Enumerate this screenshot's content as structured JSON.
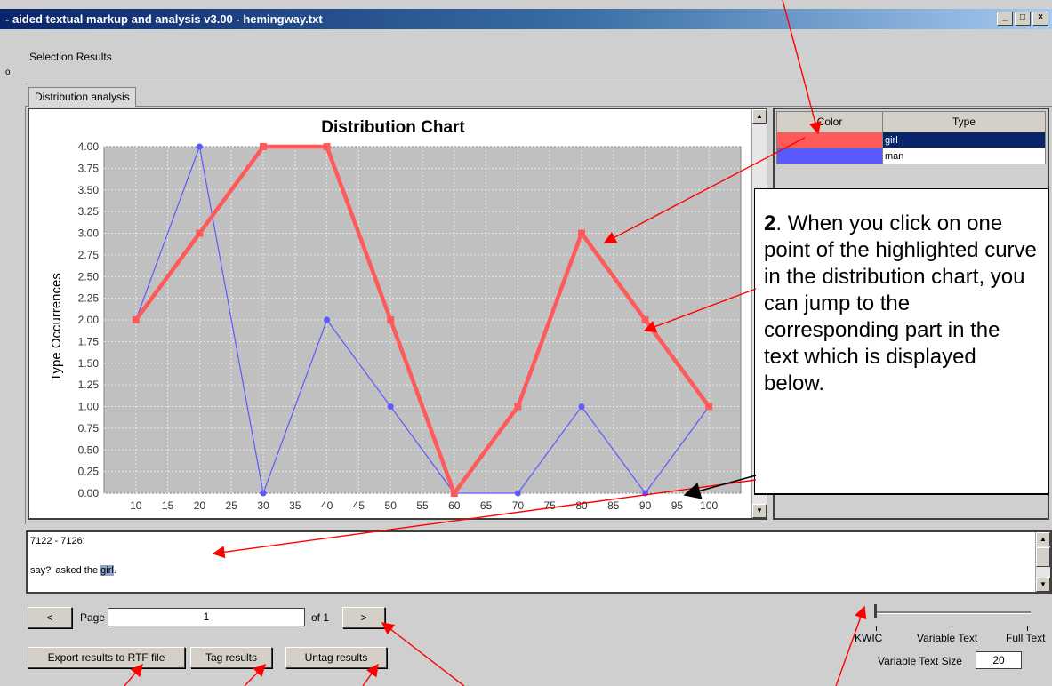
{
  "window": {
    "title": "- aided textual markup and analysis v3.00  - hemingway.txt"
  },
  "selection_results_label": "Selection Results",
  "tab_label": "Distribution analysis",
  "chart_data": {
    "type": "line",
    "title": "Distribution Chart",
    "ylabel": "Type Occurrences",
    "xlabel": "",
    "x": [
      10,
      20,
      30,
      40,
      50,
      60,
      70,
      80,
      90,
      100
    ],
    "xlim": [
      5,
      105
    ],
    "ylim": [
      0,
      4
    ],
    "x_ticks": [
      "10",
      "15",
      "20",
      "25",
      "30",
      "35",
      "40",
      "45",
      "50",
      "55",
      "60",
      "65",
      "70",
      "75",
      "80",
      "85",
      "90",
      "95",
      "100"
    ],
    "y_ticks": [
      "0.00",
      "0.25",
      "0.50",
      "0.75",
      "1.00",
      "1.25",
      "1.50",
      "1.75",
      "2.00",
      "2.25",
      "2.50",
      "2.75",
      "3.00",
      "3.25",
      "3.50",
      "3.75",
      "4.00"
    ],
    "grid": true,
    "series": [
      {
        "name": "girl",
        "color": "#ff5a5a",
        "marker": "square",
        "highlighted": true,
        "values": [
          2,
          3,
          4,
          4,
          2,
          0,
          1,
          3,
          2,
          1
        ]
      },
      {
        "name": "man",
        "color": "#5a5aff",
        "marker": "circle",
        "highlighted": false,
        "values": [
          2,
          4,
          0,
          2,
          1,
          0,
          0,
          1,
          0,
          1
        ]
      }
    ]
  },
  "legend_table": {
    "headers": [
      "Color",
      "Type"
    ],
    "rows": [
      {
        "color": "#ff5a5a",
        "type": "girl",
        "selected": true
      },
      {
        "color": "#5a5aff",
        "type": "man",
        "selected": false
      }
    ]
  },
  "note": {
    "number": "2",
    "text": ". When you click on one point of the highlighted curve in the distribution chart, you can jump to the corresponding part in the text which is displayed below."
  },
  "text_result": {
    "range": "7122 - 7126:",
    "before": "say?' asked the ",
    "match": "girl",
    "after": "."
  },
  "pager": {
    "prev": "<",
    "page_label": "Page",
    "page_value": "1",
    "of_label": "of 1",
    "next": ">"
  },
  "buttons": {
    "export": "Export results to RTF file",
    "tag": "Tag results",
    "untag": "Untag results"
  },
  "slider": {
    "labels": [
      "KWIC",
      "Variable Text",
      "Full Text"
    ],
    "value": "KWIC"
  },
  "variable_text_size": {
    "label": "Variable Text Size",
    "value": "20"
  },
  "window_buttons": [
    "_",
    "□",
    "×"
  ],
  "margin_mark": "o"
}
